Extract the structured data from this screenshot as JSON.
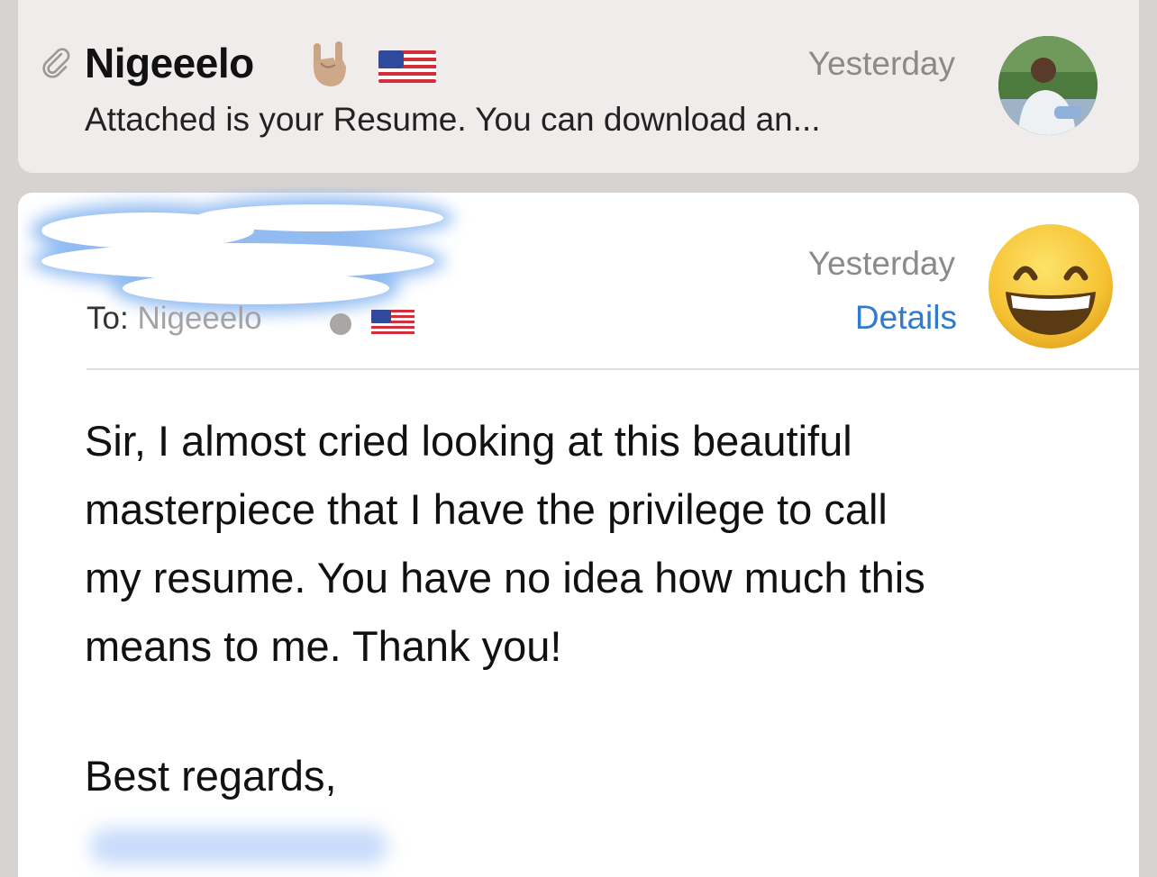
{
  "email_list_item": {
    "sender": "Nigeeelo",
    "time": "Yesterday",
    "preview": "Attached is your Resume. You can download an..."
  },
  "email_detail": {
    "to_label": "To:",
    "to_name": "Nigeeelo",
    "time": "Yesterday",
    "details_link": "Details",
    "body_lines": [
      "Sir, I almost cried looking at this beautiful",
      "masterpiece that I have the privilege to call",
      "my resume. You have no idea how much this",
      "means to me. Thank you!"
    ],
    "signoff": "Best regards,"
  },
  "colors": {
    "background": "#d6d3d1",
    "card_preview": "#efeceb",
    "card_open": "#ffffff",
    "link": "#2f7bd0",
    "muted_text": "#8c8a89"
  },
  "icons": {
    "attachment": "paperclip-icon",
    "sender_emoji": "sign-of-horns-icon",
    "flag": "us-flag-icon",
    "avatar": "sender-avatar",
    "recipient_emoji": "grinning-face-icon"
  }
}
